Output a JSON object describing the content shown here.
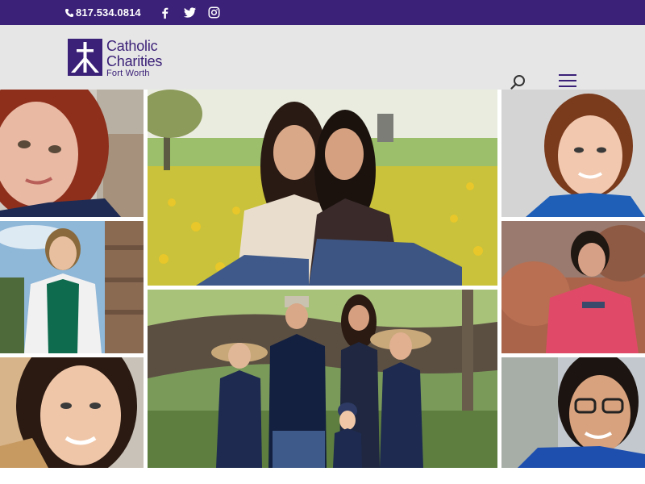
{
  "topbar": {
    "phone": "817.534.0814",
    "social": [
      "facebook-icon",
      "twitter-icon",
      "instagram-icon"
    ]
  },
  "header": {
    "logo": {
      "line1": "Catholic",
      "line2": "Charities",
      "line3": "Fort Worth"
    },
    "search_icon": "search-icon",
    "menu_icon": "hamburger-menu-icon"
  },
  "colors": {
    "brand_purple": "#3b2178",
    "header_bg": "#e6e6e6"
  },
  "collage": {
    "photos": [
      "red-haired-woman-selfie",
      "woman-in-green-scrubs",
      "smiling-woman-selfie",
      "two-sisters-in-field",
      "family-by-tree",
      "smiling-woman-blue-shirt",
      "woman-pink-sweatshirt-canyon",
      "woman-glasses-blue-scrubs"
    ]
  }
}
